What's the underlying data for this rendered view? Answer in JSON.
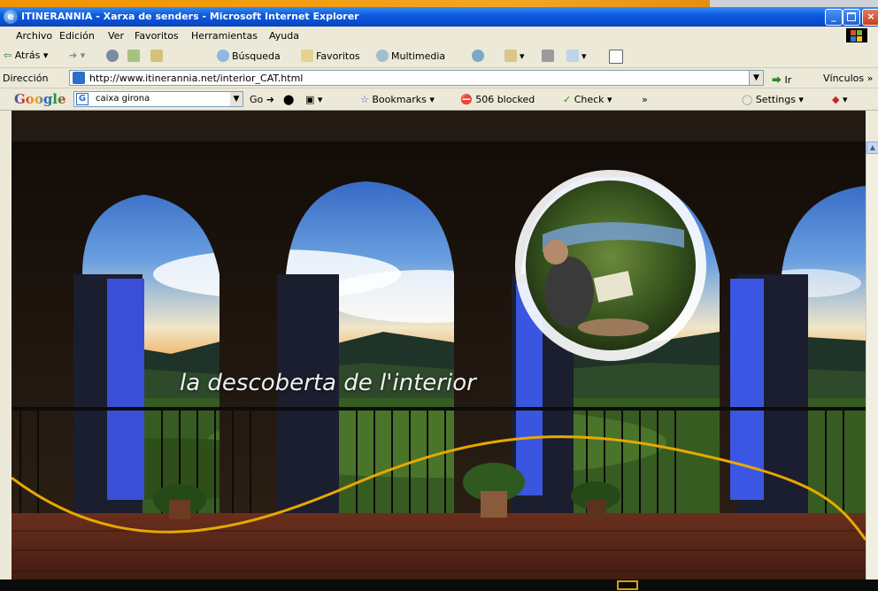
{
  "window": {
    "title": "ITINERANNIA - Xarxa de senders - Microsoft Internet Explorer",
    "controls": {
      "minimize": "_",
      "maximize": " ",
      "close": "×"
    }
  },
  "menu": {
    "items": [
      "Archivo",
      "Edición",
      "Ver",
      "Favoritos",
      "Herramientas",
      "Ayuda"
    ]
  },
  "toolbar": {
    "back": "Atrás",
    "search": "Búsqueda",
    "favorites": "Favoritos",
    "multimedia": "Multimedia"
  },
  "address": {
    "label": "Dirección",
    "url": "http://www.itinerannia.net/interior_CAT.html",
    "go": "Ir",
    "links": "Vínculos"
  },
  "google": {
    "logo": "Google",
    "search_value": "caixa girona",
    "go": "Go",
    "bookmarks": "Bookmarks",
    "blocked": "506 blocked",
    "check": "Check",
    "more": "»",
    "settings": "Settings"
  },
  "content": {
    "tagline": "la descoberta de l'interior"
  },
  "colors": {
    "accent_curve": "#e8a800",
    "title_bar": "#0d5be0"
  }
}
